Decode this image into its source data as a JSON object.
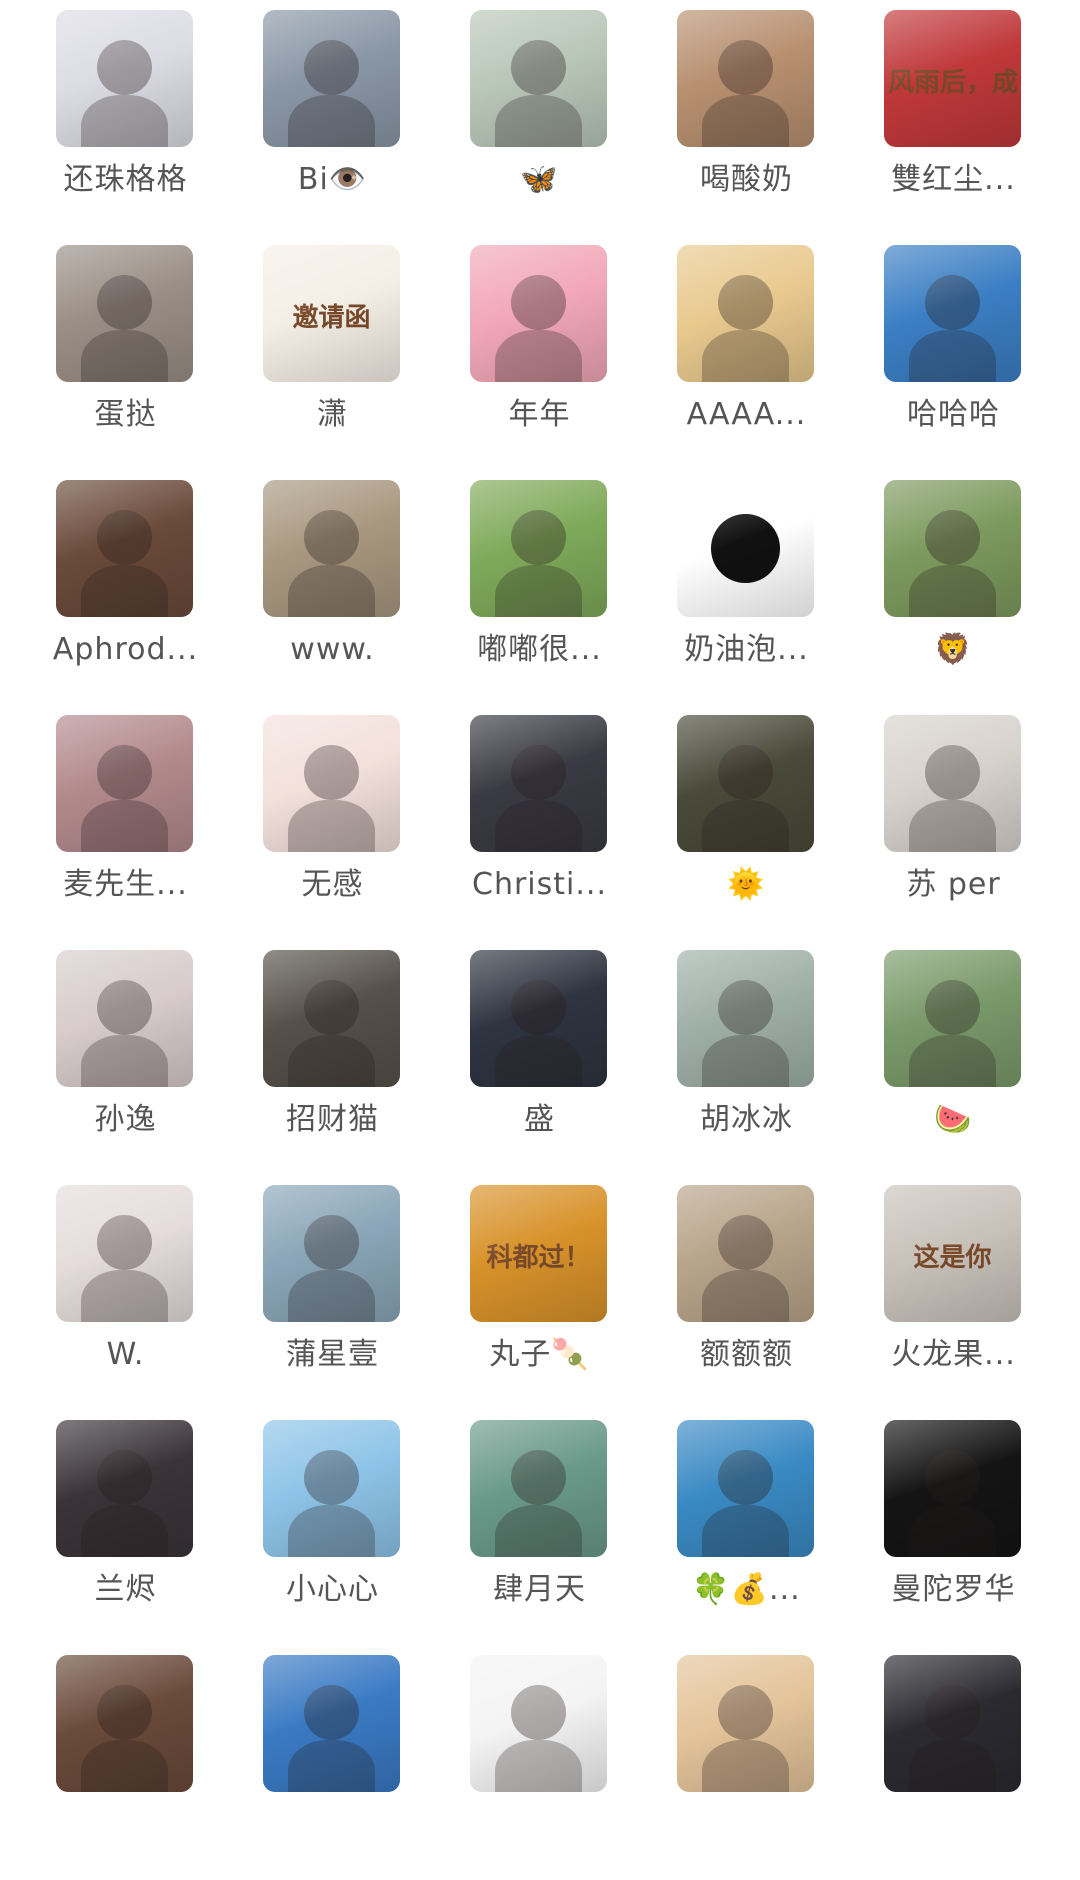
{
  "members": [
    {
      "name": "还珠格格",
      "avatar": {
        "label": "woman-in-white-photo",
        "color": "#dcdce4"
      }
    },
    {
      "name": "Bi👁️",
      "avatar": {
        "label": "woman-at-window-photo",
        "color": "#8a97a6"
      }
    },
    {
      "name": "🦋",
      "avatar": {
        "label": "woman-portrait-photo",
        "color": "#b9c7b8"
      }
    },
    {
      "name": "喝酸奶",
      "avatar": {
        "label": "person-at-desk-photo",
        "color": "#b89070"
      }
    },
    {
      "name": "雙红尘...",
      "avatar": {
        "label": "red-banner-photo",
        "color": "#c0383a",
        "text": "风雨后，成功细"
      }
    },
    {
      "name": "蛋挞",
      "avatar": {
        "label": "mirror-selfie-photo",
        "color": "#9a8f86"
      }
    },
    {
      "name": "潇",
      "avatar": {
        "label": "invitation-card-image",
        "color": "#f4efe6",
        "text": "邀请函"
      }
    },
    {
      "name": "年年",
      "avatar": {
        "label": "anime-girl-pink-illustration",
        "color": "#f2a8b8"
      }
    },
    {
      "name": "AAAA...",
      "avatar": {
        "label": "anime-girl-blonde-illustration",
        "color": "#e9c98e"
      }
    },
    {
      "name": "哈哈哈",
      "avatar": {
        "label": "beach-scene-photo",
        "color": "#3b7fc4"
      }
    },
    {
      "name": "Aphrod...",
      "avatar": {
        "label": "woman-with-emoji-photo",
        "color": "#6a4a3a"
      }
    },
    {
      "name": "www.",
      "avatar": {
        "label": "woman-with-laptop-photo",
        "color": "#a89880"
      }
    },
    {
      "name": "嘟嘟很...",
      "avatar": {
        "label": "girl-in-field-illustration",
        "color": "#7faa5a"
      }
    },
    {
      "name": "奶油泡...",
      "avatar": {
        "label": "black-cat-pink-hood-image",
        "color": "#ffffff"
      }
    },
    {
      "name": "🦁",
      "avatar": {
        "label": "woman-in-park-photo",
        "color": "#7d9a5e"
      }
    },
    {
      "name": "麦先生...",
      "avatar": {
        "label": "man-in-black-photo",
        "color": "#b38a8c"
      }
    },
    {
      "name": "无感",
      "avatar": {
        "label": "sleeping-boy-cartoon",
        "color": "#f3e1dc"
      }
    },
    {
      "name": "Christi...",
      "avatar": {
        "label": "woman-night-city-photo",
        "color": "#3a3a44"
      }
    },
    {
      "name": "🌞",
      "avatar": {
        "label": "woman-under-plant-photo",
        "color": "#4a4a3a"
      }
    },
    {
      "name": "苏 per",
      "avatar": {
        "label": "man-in-suit-photo",
        "color": "#d7d2cc"
      }
    },
    {
      "name": "孙逸",
      "avatar": {
        "label": "woman-long-hair-photo",
        "color": "#d8cccc"
      }
    },
    {
      "name": "招财猫",
      "avatar": {
        "label": "couple-sunglasses-photo",
        "color": "#555049"
      }
    },
    {
      "name": "盛",
      "avatar": {
        "label": "anime-man-dark-illustration",
        "color": "#2e3440"
      }
    },
    {
      "name": "胡冰冰",
      "avatar": {
        "label": "girl-outdoors-photo",
        "color": "#9fb0a8"
      }
    },
    {
      "name": "🍉",
      "avatar": {
        "label": "woman-with-cat-photo",
        "color": "#7a9a6a"
      }
    },
    {
      "name": "W.",
      "avatar": {
        "label": "woman-close-up-photo",
        "color": "#e6dcdc"
      }
    },
    {
      "name": "蒲星壹",
      "avatar": {
        "label": "woman-in-car-photo",
        "color": "#8aa6b8"
      }
    },
    {
      "name": "丸子🍡",
      "avatar": {
        "label": "man-thumbs-up-poster",
        "color": "#d8922a",
        "text": "科都过！"
      }
    },
    {
      "name": "额额额",
      "avatar": {
        "label": "tent-view-photo",
        "color": "#b8a48a"
      }
    },
    {
      "name": "火龙果...",
      "avatar": {
        "label": "white-cat-meme",
        "color": "#c8c2ba",
        "text": "这是你"
      }
    },
    {
      "name": "兰烬",
      "avatar": {
        "label": "white-hair-girl-photo",
        "color": "#3a3438"
      }
    },
    {
      "name": "小心心",
      "avatar": {
        "label": "child-sunglasses-photo",
        "color": "#8ec4e8"
      }
    },
    {
      "name": "肆月天",
      "avatar": {
        "label": "woman-sleeping-photo",
        "color": "#6a9a8a"
      }
    },
    {
      "name": "🍀💰...",
      "avatar": {
        "label": "mountain-lake-painting",
        "color": "#3a8ac4"
      }
    },
    {
      "name": "曼陀罗华",
      "avatar": {
        "label": "black-flower-art",
        "color": "#141414"
      }
    },
    {
      "name": "",
      "avatar": {
        "label": "food-on-table-photo",
        "color": "#6a4a3a"
      }
    },
    {
      "name": "",
      "avatar": {
        "label": "woman-by-sea-photo",
        "color": "#3a7ac4"
      }
    },
    {
      "name": "",
      "avatar": {
        "label": "sleeping-cartoon-sketch",
        "color": "#f4f4f4"
      }
    },
    {
      "name": "",
      "avatar": {
        "label": "man-at-sunset-photo",
        "color": "#e4c49a"
      }
    },
    {
      "name": "",
      "avatar": {
        "label": "woman-reading-photo",
        "color": "#2a2a30"
      }
    }
  ]
}
